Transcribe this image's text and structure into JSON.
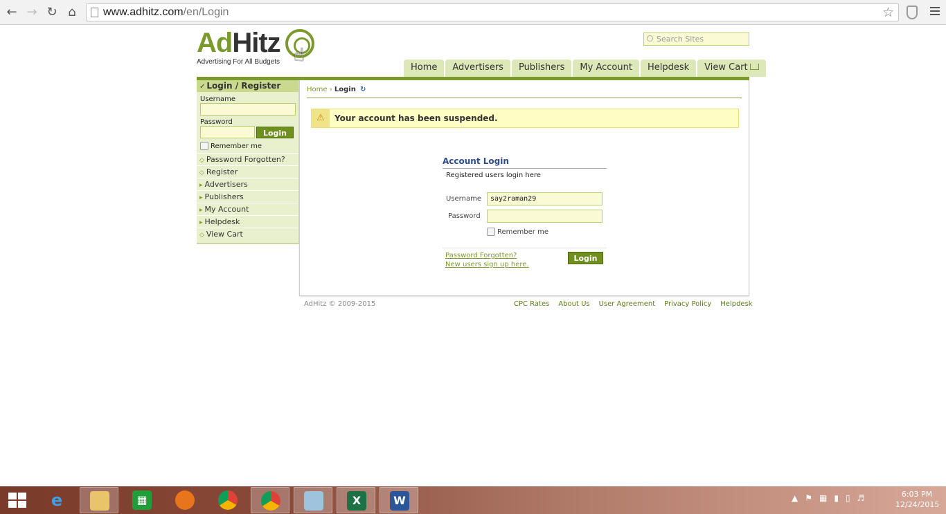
{
  "browser": {
    "url_domain": "www.adhitz.com",
    "url_path": "/en/Login"
  },
  "site": {
    "logo_ad": "Ad",
    "logo_hitz": "Hitz",
    "tagline": "Advertising For All Budgets",
    "search_placeholder": "Search Sites",
    "nav": [
      "Home",
      "Advertisers",
      "Publishers",
      "My Account",
      "Helpdesk",
      "View Cart"
    ]
  },
  "sidebar": {
    "heading": "Login / Register",
    "username_label": "Username",
    "password_label": "Password",
    "login_button": "Login",
    "remember_label": "Remember me",
    "links": [
      "Password Forgotten?",
      "Register",
      "Advertisers",
      "Publishers",
      "My Account",
      "Helpdesk",
      "View Cart"
    ]
  },
  "main": {
    "breadcrumb_home": "Home",
    "breadcrumb_sep": "›",
    "breadcrumb_current": "Login",
    "alert_message": "Your account has been suspended.",
    "login_title": "Account Login",
    "login_subtitle": "Registered users login here",
    "username_label": "Username",
    "username_value": "say2raman29",
    "password_label": "Password",
    "remember_label": "Remember me",
    "forgot_link": "Password Forgotten?",
    "signup_link": "New users sign up here.",
    "login_button": "Login"
  },
  "footer": {
    "copyright": "AdHitz © 2009-2015",
    "links": [
      "CPC Rates",
      "About Us",
      "User Agreement",
      "Privacy Policy",
      "Helpdesk"
    ]
  },
  "taskbar": {
    "time": "6:03 PM",
    "date": "12/24/2015"
  }
}
